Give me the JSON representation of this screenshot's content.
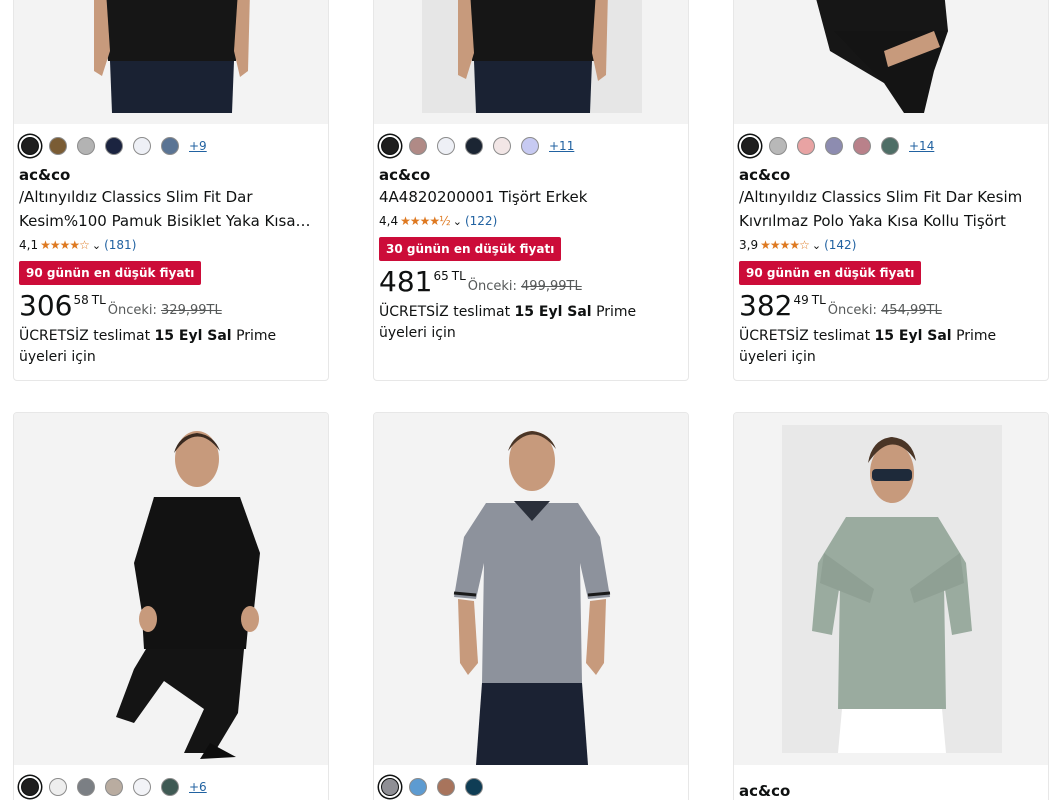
{
  "products": [
    {
      "brand": "ac&co",
      "title": "/Altınyıldız Classics Slim Fit Dar Kesim%100 Pamuk Bisiklet Yaka Kısa…",
      "rating": "4,1",
      "stars": "★★★★☆",
      "review_count": "(181)",
      "more_colors": "+9",
      "swatches": [
        "#1f1f1f",
        "#7a5c34",
        "#b3b3b3",
        "#1b2440",
        "#eef0f6",
        "#5a7494"
      ],
      "deal_badge": "90 günün en düşük fiyatı",
      "price_whole": "306",
      "price_fraction": "58",
      "currency": "TL",
      "prev_label": "Önceki:",
      "prev_price": "329,99TL",
      "delivery_prefix": "ÜCRETSİZ teslimat",
      "delivery_date": "15 Eyl Sal",
      "delivery_suffix": "Prime üyeleri için"
    },
    {
      "brand": "ac&co",
      "title": "4A4820200001 Tişört Erkek",
      "rating": "4,4",
      "stars": "★★★★½",
      "review_count": "(122)",
      "more_colors": "+11",
      "swatches": [
        "#1f1f1f",
        "#b08a86",
        "#eef0f6",
        "#1b2533",
        "#f2e6e6",
        "#c7caf2"
      ],
      "deal_badge": "30 günün en düşük fiyatı",
      "price_whole": "481",
      "price_fraction": "65",
      "currency": "TL",
      "prev_label": "Önceki:",
      "prev_price": "499,99TL",
      "delivery_prefix": "ÜCRETSİZ teslimat",
      "delivery_date": "15 Eyl Sal",
      "delivery_suffix": "Prime üyeleri için"
    },
    {
      "brand": "ac&co",
      "title": "/Altınyıldız Classics Slim Fit Dar Kesim Kıvrılmaz Polo Yaka Kısa Kollu Tişört",
      "rating": "3,9",
      "stars": "★★★★☆",
      "review_count": "(142)",
      "more_colors": "+14",
      "swatches": [
        "#1f1f1f",
        "#b8b8b8",
        "#e8a3a3",
        "#8d8cb0",
        "#b9818a",
        "#4e6e66"
      ],
      "deal_badge": "90 günün en düşük fiyatı",
      "price_whole": "382",
      "price_fraction": "49",
      "currency": "TL",
      "prev_label": "Önceki:",
      "prev_price": "454,99TL",
      "delivery_prefix": "ÜCRETSİZ teslimat",
      "delivery_date": "15 Eyl Sal",
      "delivery_suffix": "Prime üyeleri için"
    },
    {
      "more_colors": "+6",
      "swatches": [
        "#1f1f1f",
        "#eeeeee",
        "#7b7f84",
        "#b9aca0",
        "#f2f3f7",
        "#3f5a54"
      ]
    },
    {
      "swatches": [
        "#8f8f95",
        "#5d9bd1",
        "#a8745c",
        "#0f3d55"
      ]
    },
    {
      "brand": "ac&co"
    }
  ]
}
